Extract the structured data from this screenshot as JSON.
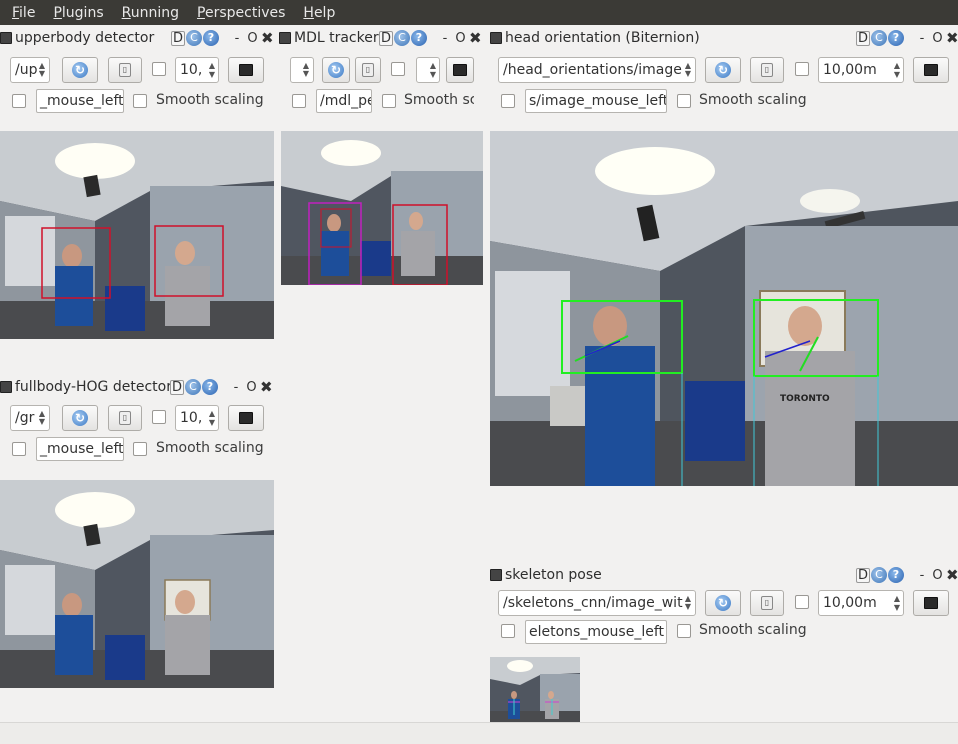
{
  "menubar": {
    "items": [
      {
        "label": "File",
        "accel": "F",
        "rest": "ile"
      },
      {
        "label": "Plugins",
        "accel": "P",
        "rest": "lugins"
      },
      {
        "label": "Running",
        "accel": "R",
        "rest": "unning"
      },
      {
        "label": "Perspectives",
        "accel": "P",
        "rest": "erspectives"
      },
      {
        "label": "Help",
        "accel": "H",
        "rest": "elp"
      }
    ]
  },
  "title_controls": {
    "d": "D",
    "refresh": "C",
    "help": "?",
    "minimize": "-",
    "float": "O",
    "close": "✖"
  },
  "panels": {
    "upperbody": {
      "title": "upperbody detector",
      "topic": "/up",
      "zoom": "10,",
      "mouse_topic": "_mouse_left",
      "smooth": "Smooth scaling"
    },
    "mdl": {
      "title": "MDL tracker",
      "topic": "",
      "mouse_topic": "/mdl_pe",
      "smooth": "Smooth sc"
    },
    "head": {
      "title": "head orientation (Biternion)",
      "topic": "/head_orientations/image",
      "zoom": "10,00m",
      "mouse_topic": "s/image_mouse_left",
      "smooth": "Smooth scaling"
    },
    "fullbody": {
      "title": "fullbody-HOG detector",
      "topic": "/gr",
      "zoom": "10,",
      "mouse_topic": "_mouse_left",
      "smooth": "Smooth scaling"
    },
    "skeleton": {
      "title": "skeleton pose",
      "topic": "/skeletons_cnn/image_wit",
      "zoom": "10,00m",
      "mouse_topic": "eletons_mouse_left",
      "smooth": "Smooth scaling"
    }
  },
  "image_labels": {
    "shirt_text": "TORONTO"
  },
  "colors": {
    "menubar_bg": "#3b3a36",
    "workspace_bg": "#f2f1f0",
    "detection_red": "#d0102a",
    "detection_green": "#22ee22",
    "track_magenta": "#c020c0",
    "skeleton_cyan": "#40c8d8"
  }
}
